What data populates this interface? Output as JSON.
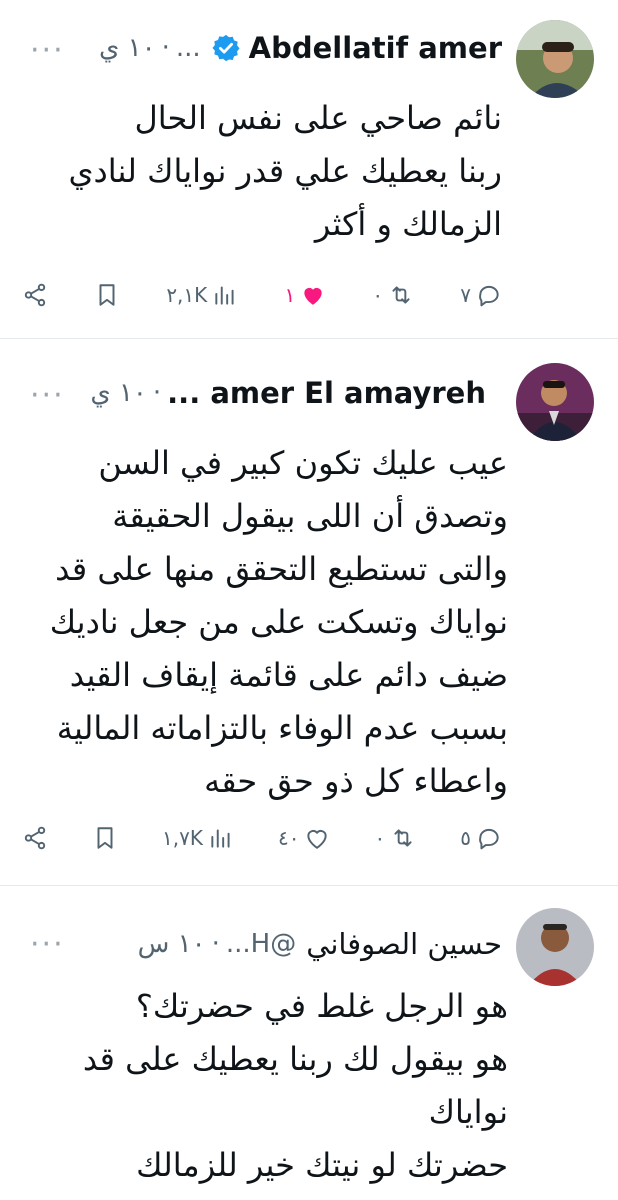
{
  "tweets": [
    {
      "author": "Abdellatif amer",
      "handle": "...",
      "time": "١٠ ي",
      "text": "نائم صاحي على نفس الحال\nربنا يعطيك علي قدر نواياك لنادي\nالزمالك و أكثر",
      "replies": "٧",
      "retweets": "٠",
      "likes": "١",
      "views": "٢,١K",
      "liked": true,
      "verified": true
    },
    {
      "author": "amer El amayreh ...",
      "handle": "",
      "time": "١٠ ي",
      "text": "عيب عليك تكون كبير في السن\nوتصدق أن اللى بيقول الحقيقة\nوالتى تستطيع التحقق منها على قد\nنواياك وتسكت على من جعل ناديك\nضيف دائم على قائمة إيقاف القيد\nبسبب عدم الوفاء بالتزاماته المالية\nواعطاء كل ذو حق حقه",
      "replies": "٥",
      "retweets": "٠",
      "likes": "٤٠",
      "views": "١,٧K",
      "liked": false,
      "verified": false
    },
    {
      "author": "حسين الصوفاني",
      "handle": "@H...",
      "time": "١٠ س",
      "text": "هو الرجل غلط في حضرتك؟\nهو بيقول لك ربنا يعطيك على قد\nنواياك\nحضرتك لو نيتك خير للزمالك",
      "verified": false
    }
  ],
  "icons": {
    "more": "more-icon",
    "reply": "reply-icon",
    "retweet": "retweet-icon",
    "like": "heart-icon",
    "views": "views-icon",
    "bookmark": "bookmark-icon",
    "share": "share-icon",
    "verified": "verified-badge-icon"
  },
  "colors": {
    "like_active": "#f91880",
    "secondary_text": "#536471",
    "verified": "#1d9bf0"
  }
}
